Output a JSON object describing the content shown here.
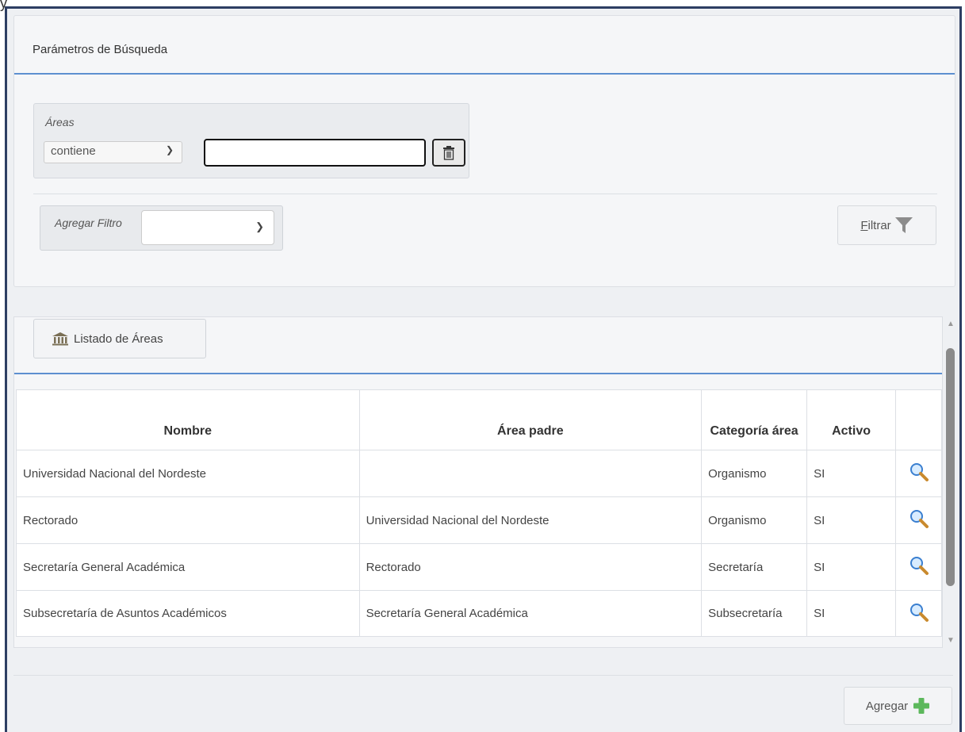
{
  "stray_char": "y",
  "search": {
    "title": "Parámetros de Búsqueda",
    "area_label": "Áreas",
    "condition_value": "contiene",
    "text_value": "",
    "add_filter_label": "Agregar Filtro",
    "add_filter_value": "",
    "filter_button_underlined": "F",
    "filter_button_rest": "iltrar"
  },
  "listing": {
    "tab_label": "Listado de Áreas",
    "columns": [
      "Nombre",
      "Área padre",
      "Categoría área",
      "Activo"
    ],
    "rows": [
      {
        "nombre": "Universidad Nacional del Nordeste",
        "padre": "",
        "categoria": "Organismo",
        "activo": "SI"
      },
      {
        "nombre": "Rectorado",
        "padre": "Universidad Nacional del Nordeste",
        "categoria": "Organismo",
        "activo": "SI"
      },
      {
        "nombre": "Secretaría General Académica",
        "padre": "Rectorado",
        "categoria": "Secretaría",
        "activo": "SI"
      },
      {
        "nombre": "Subsecretaría de Asuntos Académicos",
        "padre": "Secretaría General Académica",
        "categoria": "Subsecretaría",
        "activo": "SI"
      }
    ]
  },
  "footer": {
    "add_button_label": "Agregar"
  },
  "icons": {
    "trash": "trash-icon",
    "filter": "funnel-icon",
    "institution": "institution-icon",
    "view": "magnifier-icon",
    "add": "plus-icon"
  },
  "colors": {
    "frame_border": "#2d3e63",
    "title_rule": "#5d8fd0",
    "plus_green": "#5cb85c",
    "magnifier_blue": "#3a7fd0"
  }
}
